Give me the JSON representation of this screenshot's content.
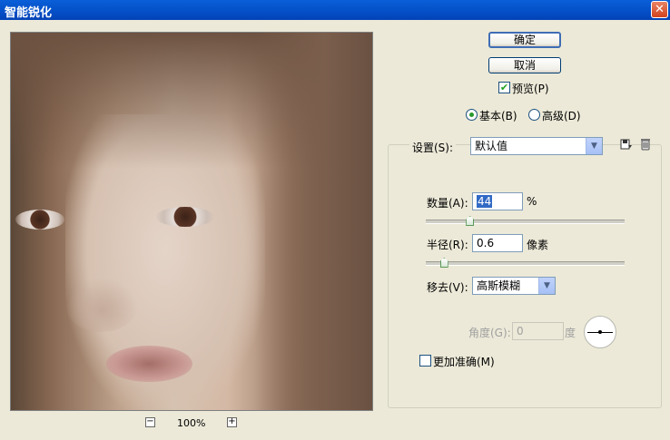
{
  "window": {
    "title": "智能锐化"
  },
  "preview": {
    "zoom": "100%",
    "zoom_out": "−",
    "zoom_in": "+"
  },
  "buttons": {
    "ok": "确定",
    "cancel": "取消"
  },
  "preview_toggle": {
    "label": "预览(P)",
    "checked": true
  },
  "mode": {
    "basic": "基本(B)",
    "advanced": "高级(D)",
    "selected": "basic"
  },
  "settings": {
    "label": "设置(S):",
    "value": "默认值"
  },
  "amount": {
    "label": "数量(A):",
    "value": "44",
    "unit": "%",
    "slider_fraction": 0.22
  },
  "radius": {
    "label": "半径(R):",
    "value": "0.6",
    "unit": "像素",
    "slider_fraction": 0.09
  },
  "remove": {
    "label": "移去(V):",
    "value": "高斯模糊"
  },
  "angle": {
    "label": "角度(G):",
    "value": "0",
    "unit": "度"
  },
  "more_accurate": {
    "label": "更加准确(M)",
    "checked": false
  }
}
